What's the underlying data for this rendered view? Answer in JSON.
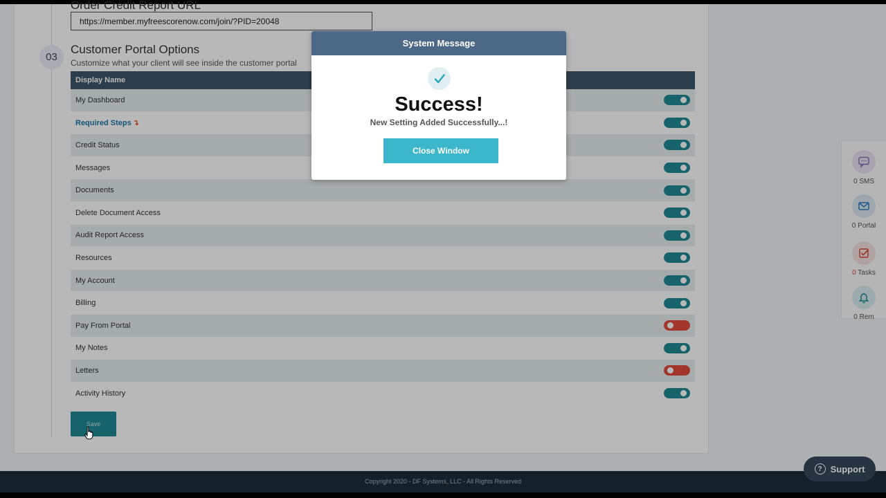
{
  "credit_report": {
    "heading": "Order Credit Report URL",
    "url": "https://member.myfreescorenow.com/join/?PID=20048"
  },
  "portal_options": {
    "step_number": "03",
    "title": "Customer Portal Options",
    "subtitle": "Customize what your client will see inside the customer portal",
    "column_header": "Display Name",
    "rows": [
      {
        "label": "My Dashboard",
        "enabled": true
      },
      {
        "label": "Required Steps",
        "enabled": true,
        "highlight": true,
        "marker": "↴"
      },
      {
        "label": "Credit Status",
        "enabled": true
      },
      {
        "label": "Messages",
        "enabled": true
      },
      {
        "label": "Documents",
        "enabled": true
      },
      {
        "label": "Delete Document Access",
        "enabled": true
      },
      {
        "label": "Audit Report Access",
        "enabled": true
      },
      {
        "label": "Resources",
        "enabled": true
      },
      {
        "label": "My Account",
        "enabled": true
      },
      {
        "label": "Billing",
        "enabled": true
      },
      {
        "label": "Pay From Portal",
        "enabled": false
      },
      {
        "label": "My Notes",
        "enabled": true
      },
      {
        "label": "Letters",
        "enabled": false
      },
      {
        "label": "Activity History",
        "enabled": true
      }
    ],
    "save_label": "Save"
  },
  "side_panel": {
    "sms": {
      "count": "0",
      "label": "SMS",
      "icon": "chat-icon"
    },
    "portal": {
      "count": "0",
      "label": "Portal",
      "icon": "envelope-icon"
    },
    "tasks": {
      "count": "0",
      "label": "Tasks",
      "icon": "checkbox-icon"
    },
    "rem": {
      "count": "0",
      "label": "Rem",
      "icon": "bell-icon"
    }
  },
  "footer": {
    "copyright": "Copyright 2020 - DF Systems, LLC - All Rights Reserved"
  },
  "support": {
    "label": "Support"
  },
  "modal": {
    "header": "System Message",
    "title": "Success!",
    "message": "New Setting Added Successfully...!",
    "close_label": "Close Window"
  },
  "colors": {
    "accent": "#1f8a96",
    "toggle_off": "#e24b3e",
    "table_header": "#3d5569",
    "modal_header": "#4b6886",
    "modal_button": "#3bb6cb"
  }
}
